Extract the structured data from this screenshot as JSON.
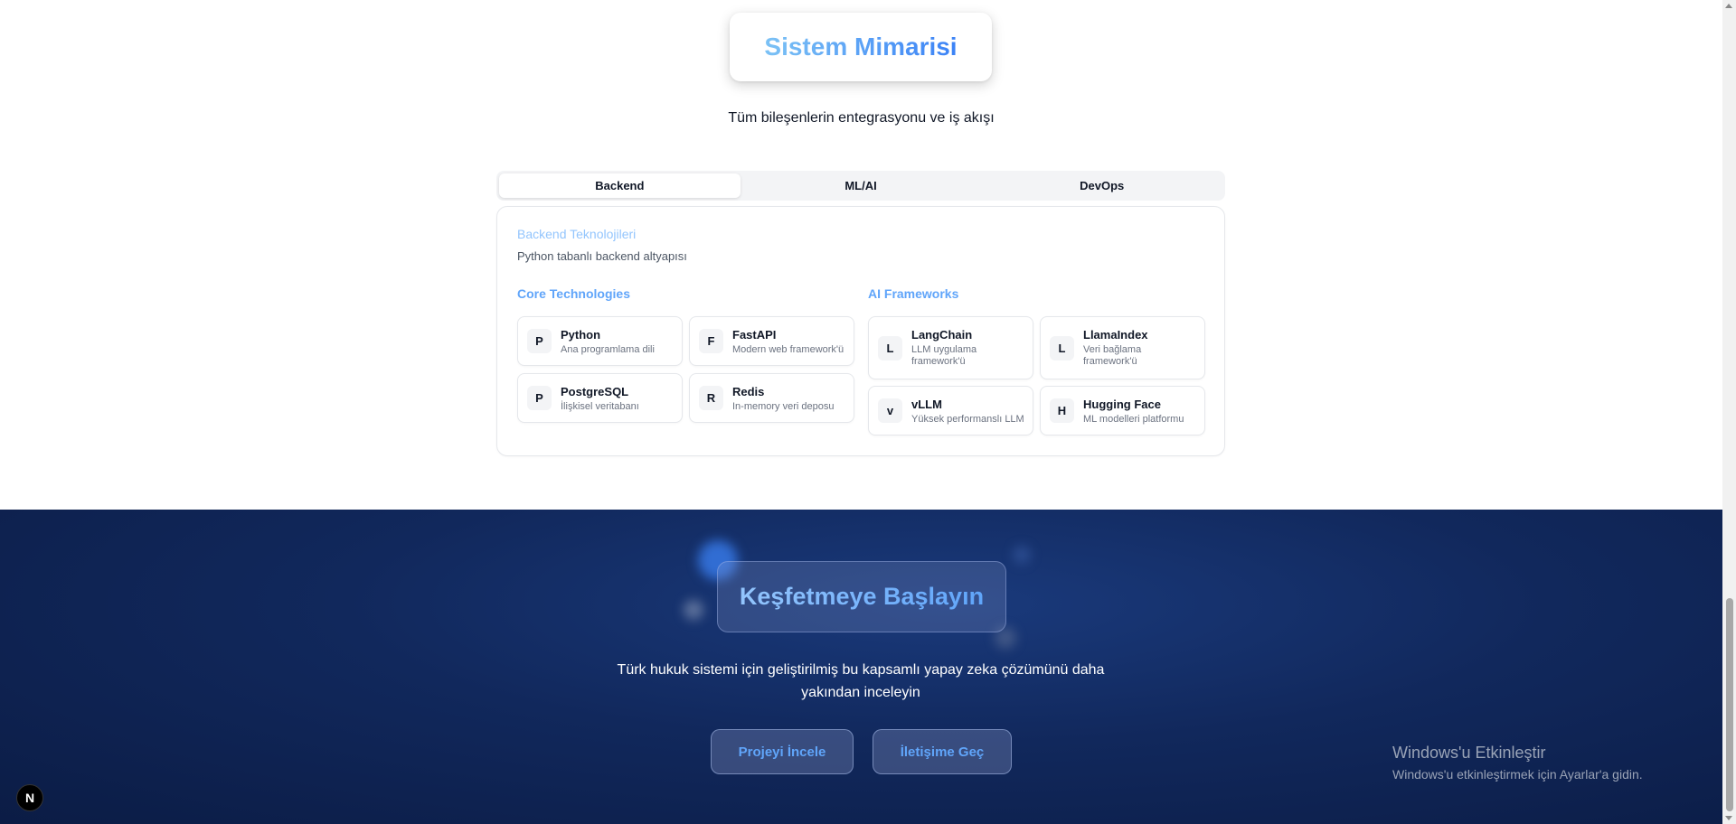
{
  "architecture": {
    "title": "Sistem Mimarisi",
    "subtitle": "Tüm bileşenlerin entegrasyonu ve iş akışı",
    "tabs": [
      "Backend",
      "ML/AI",
      "DevOps"
    ],
    "active_tab": "Backend",
    "panel": {
      "title": "Backend Teknolojileri",
      "description": "Python tabanlı backend altyapısı",
      "groups": [
        {
          "title": "Core Technologies",
          "items": [
            {
              "badge": "P",
              "name": "Python",
              "desc": "Ana programlama dili"
            },
            {
              "badge": "F",
              "name": "FastAPI",
              "desc": "Modern web framework'ü"
            },
            {
              "badge": "P",
              "name": "PostgreSQL",
              "desc": "İlişkisel veritabanı"
            },
            {
              "badge": "R",
              "name": "Redis",
              "desc": "In-memory veri deposu"
            }
          ]
        },
        {
          "title": "AI Frameworks",
          "items": [
            {
              "badge": "L",
              "name": "LangChain",
              "desc": "LLM uygulama framework'ü"
            },
            {
              "badge": "L",
              "name": "LlamaIndex",
              "desc": "Veri bağlama framework'ü"
            },
            {
              "badge": "v",
              "name": "vLLM",
              "desc": "Yüksek performanslı LLM"
            },
            {
              "badge": "H",
              "name": "Hugging Face",
              "desc": "ML modelleri platformu"
            }
          ]
        }
      ]
    }
  },
  "cta": {
    "title": "Keşfetmeye Başlayın",
    "text": "Türk hukuk sistemi için geliştirilmiş bu kapsamlı yapay zeka çözümünü daha yakından inceleyin",
    "primary_button": "Projeyi İncele",
    "secondary_button": "İletişime Geç"
  },
  "windows_watermark": {
    "title": "Windows'u Etkinleştir",
    "subtitle": "Windows'u etkinleştirmek için Ayarlar'a gidin."
  },
  "next_badge": "N",
  "colors": {
    "accent": "#3b82f6",
    "light_accent": "#93c5fd",
    "dark_bg": "#11285c"
  }
}
